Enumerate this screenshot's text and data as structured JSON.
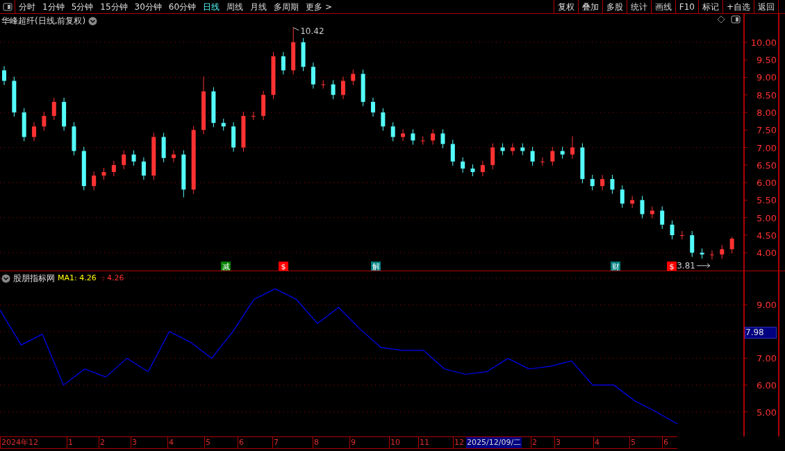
{
  "toolbar": {
    "periods": [
      {
        "label": "分时",
        "selected": false
      },
      {
        "label": "1分钟",
        "selected": false
      },
      {
        "label": "5分钟",
        "selected": false
      },
      {
        "label": "15分钟",
        "selected": false
      },
      {
        "label": "30分钟",
        "selected": false
      },
      {
        "label": "60分钟",
        "selected": false
      },
      {
        "label": "日线",
        "selected": true
      },
      {
        "label": "周线",
        "selected": false
      },
      {
        "label": "月线",
        "selected": false
      },
      {
        "label": "多周期",
        "selected": false
      },
      {
        "label": "更多 >",
        "selected": false
      }
    ],
    "buttons": [
      "复权",
      "叠加",
      "多股",
      "统计",
      "画线",
      "F10",
      "标记",
      "+自选",
      "返回"
    ]
  },
  "main_chart": {
    "title": "华峰超纤(日线,前复权)",
    "high_label": "10.42",
    "low_label": "3.81",
    "signals": [
      {
        "label": "减",
        "color": "#008000"
      },
      {
        "label": "$",
        "color": "#ff0000"
      },
      {
        "label": "解",
        "color": "#008080"
      },
      {
        "label": "财",
        "color": "#008080"
      },
      {
        "label": "$",
        "color": "#ff0000"
      }
    ],
    "chart_data": {
      "type": "candlestick",
      "grid": true,
      "ohlc": [
        [
          9.2,
          9.32,
          8.78,
          8.9
        ],
        [
          8.9,
          9.02,
          7.88,
          8.0
        ],
        [
          8.0,
          8.12,
          7.18,
          7.3
        ],
        [
          7.3,
          7.72,
          7.18,
          7.6
        ],
        [
          7.6,
          8.02,
          7.48,
          7.9
        ],
        [
          7.9,
          8.42,
          7.78,
          8.3
        ],
        [
          8.3,
          8.42,
          7.48,
          7.6
        ],
        [
          7.6,
          7.72,
          6.78,
          6.9
        ],
        [
          6.9,
          7.02,
          5.78,
          5.9
        ],
        [
          5.9,
          6.32,
          5.78,
          6.2
        ],
        [
          6.2,
          6.42,
          6.08,
          6.3
        ],
        [
          6.3,
          6.62,
          6.18,
          6.5
        ],
        [
          6.5,
          6.92,
          6.38,
          6.8
        ],
        [
          6.8,
          6.92,
          6.48,
          6.6
        ],
        [
          6.6,
          6.72,
          6.08,
          6.2
        ],
        [
          6.2,
          7.42,
          6.08,
          7.3
        ],
        [
          7.3,
          7.42,
          6.58,
          6.7
        ],
        [
          6.7,
          6.92,
          6.58,
          6.8
        ],
        [
          6.8,
          6.92,
          5.58,
          5.8
        ],
        [
          5.8,
          7.62,
          5.68,
          7.5
        ],
        [
          7.5,
          9.02,
          7.38,
          8.6
        ],
        [
          8.6,
          8.72,
          7.58,
          7.7
        ],
        [
          7.7,
          7.82,
          7.48,
          7.6
        ],
        [
          7.6,
          7.72,
          6.88,
          7.0
        ],
        [
          7.0,
          8.02,
          6.88,
          7.9
        ],
        [
          7.9,
          8.02,
          7.78,
          7.9
        ],
        [
          7.9,
          8.62,
          7.78,
          8.5
        ],
        [
          8.5,
          9.72,
          8.38,
          9.6
        ],
        [
          9.6,
          9.72,
          9.08,
          9.2
        ],
        [
          9.2,
          10.42,
          9.08,
          10.0
        ],
        [
          10.0,
          10.12,
          9.18,
          9.3
        ],
        [
          9.3,
          9.42,
          8.68,
          8.8
        ],
        [
          8.8,
          8.92,
          8.68,
          8.8
        ],
        [
          8.8,
          8.92,
          8.38,
          8.5
        ],
        [
          8.5,
          9.02,
          8.38,
          8.9
        ],
        [
          8.9,
          9.22,
          8.78,
          9.1
        ],
        [
          9.1,
          9.22,
          8.18,
          8.3
        ],
        [
          8.3,
          8.42,
          7.88,
          8.0
        ],
        [
          8.0,
          8.12,
          7.48,
          7.6
        ],
        [
          7.6,
          7.72,
          7.18,
          7.3
        ],
        [
          7.3,
          7.52,
          7.18,
          7.4
        ],
        [
          7.4,
          7.52,
          7.08,
          7.2
        ],
        [
          7.2,
          7.32,
          7.08,
          7.2
        ],
        [
          7.2,
          7.52,
          7.08,
          7.4
        ],
        [
          7.4,
          7.52,
          6.98,
          7.1
        ],
        [
          7.1,
          7.22,
          6.48,
          6.6
        ],
        [
          6.6,
          6.72,
          6.28,
          6.4
        ],
        [
          6.4,
          6.52,
          6.18,
          6.3
        ],
        [
          6.3,
          6.62,
          6.18,
          6.5
        ],
        [
          6.5,
          7.12,
          6.38,
          7.0
        ],
        [
          7.0,
          7.12,
          6.78,
          6.9
        ],
        [
          6.9,
          7.12,
          6.78,
          7.0
        ],
        [
          7.0,
          7.12,
          6.78,
          6.9
        ],
        [
          6.9,
          7.02,
          6.48,
          6.6
        ],
        [
          6.6,
          6.72,
          6.48,
          6.6
        ],
        [
          6.6,
          7.02,
          6.48,
          6.9
        ],
        [
          6.9,
          7.02,
          6.68,
          6.8
        ],
        [
          6.8,
          7.32,
          6.68,
          7.0
        ],
        [
          7.0,
          7.12,
          5.98,
          6.1
        ],
        [
          6.1,
          6.22,
          5.78,
          5.9
        ],
        [
          5.9,
          6.22,
          5.78,
          6.1
        ],
        [
          6.1,
          6.22,
          5.68,
          5.8
        ],
        [
          5.8,
          5.92,
          5.28,
          5.4
        ],
        [
          5.4,
          5.62,
          5.28,
          5.5
        ],
        [
          5.5,
          5.62,
          4.98,
          5.1
        ],
        [
          5.1,
          5.32,
          4.98,
          5.2
        ],
        [
          5.2,
          5.32,
          4.68,
          4.8
        ],
        [
          4.8,
          4.92,
          4.38,
          4.5
        ],
        [
          4.5,
          4.62,
          4.38,
          4.5
        ],
        [
          4.5,
          4.62,
          3.88,
          4.0
        ],
        [
          4.0,
          4.12,
          3.83,
          3.95
        ],
        [
          3.95,
          4.07,
          3.81,
          3.95
        ],
        [
          3.95,
          4.22,
          3.83,
          4.1
        ],
        [
          4.1,
          4.45,
          3.98,
          4.4
        ]
      ],
      "ylim": [
        3.49,
        10.81
      ],
      "yticks": [
        {
          "value": 4,
          "label": "4.00"
        },
        {
          "value": 4.5,
          "label": "4.50"
        },
        {
          "value": 5,
          "label": "5.00"
        },
        {
          "value": 5.5,
          "label": "5.50"
        },
        {
          "value": 6,
          "label": "6.00"
        },
        {
          "value": 6.5,
          "label": "6.50"
        },
        {
          "value": 7,
          "label": "7.00"
        },
        {
          "value": 7.5,
          "label": "7.50"
        },
        {
          "value": 8,
          "label": "8.00"
        },
        {
          "value": 8.5,
          "label": "8.50"
        },
        {
          "value": 9,
          "label": "9.00"
        },
        {
          "value": 9.5,
          "label": "9.50"
        },
        {
          "value": 10,
          "label": "10.00"
        }
      ]
    }
  },
  "indicator_chart": {
    "name": "股朋指标网",
    "ma_value": ": 4.26",
    "ma_value_2": ": 4.26",
    "cursor_value": "7.98",
    "chart_data": {
      "type": "line",
      "grid": true,
      "series": [
        {
          "name": "MA1",
          "color": "#0000ff",
          "values": [
            8.8,
            7.5,
            7.9,
            6.0,
            6.6,
            6.3,
            7.0,
            6.5,
            8.0,
            7.6,
            7.0,
            8.0,
            9.2,
            9.6,
            9.2,
            8.3,
            8.9,
            8.1,
            7.4,
            7.3,
            7.3,
            6.6,
            6.4,
            6.5,
            7.0,
            6.6,
            6.7,
            6.9,
            6.0,
            6.0,
            5.4,
            5.0,
            4.55
          ]
        }
      ],
      "ylim": [
        4.08,
        10.25
      ],
      "yticks": [
        {
          "value": 5,
          "label": "5.00"
        },
        {
          "value": 6,
          "label": "6.00"
        },
        {
          "value": 7,
          "label": "7.00"
        },
        {
          "value": 9,
          "label": "9.00"
        }
      ]
    }
  },
  "date_axis": {
    "labels": [
      "2024年12",
      "1",
      "2",
      "3",
      "4",
      "5",
      "6",
      "7",
      "8",
      "9",
      "10",
      "11",
      "12",
      "2",
      "3",
      "4",
      "5",
      "6"
    ],
    "cursor_date": "2025/12/09/二"
  }
}
